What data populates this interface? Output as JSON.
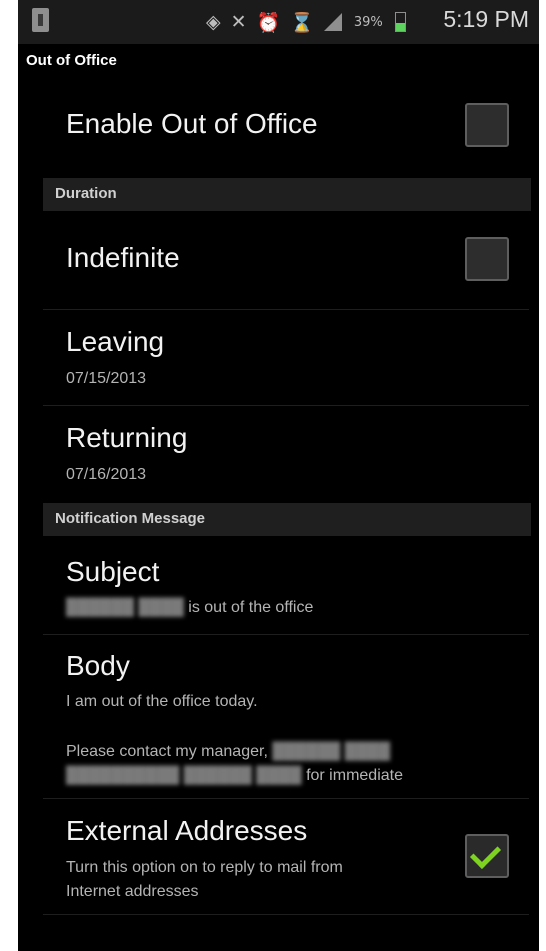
{
  "status_bar": {
    "battery_percent": "39%",
    "time": "5:19 PM"
  },
  "header": {
    "title": "Out of Office"
  },
  "enable": {
    "label": "Enable Out of Office",
    "checked": false
  },
  "duration": {
    "header": "Duration",
    "indefinite": {
      "label": "Indefinite",
      "checked": false
    },
    "leaving": {
      "label": "Leaving",
      "value": "07/15/2013"
    },
    "returning": {
      "label": "Returning",
      "value": "07/16/2013"
    }
  },
  "notification": {
    "header": "Notification Message",
    "subject": {
      "label": "Subject",
      "value": "is out of the office"
    },
    "body": {
      "label": "Body",
      "line1": "I am out of the office today.",
      "line2": "Please contact my manager,",
      "line3": "for immediate"
    }
  },
  "external": {
    "label": "External Addresses",
    "desc1": "Turn this option on to reply to mail from",
    "desc2": "Internet addresses",
    "checked": true
  },
  "colors": {
    "accent_check": "#7ed321",
    "background": "#000000",
    "section_bg": "#1f1f1f"
  }
}
